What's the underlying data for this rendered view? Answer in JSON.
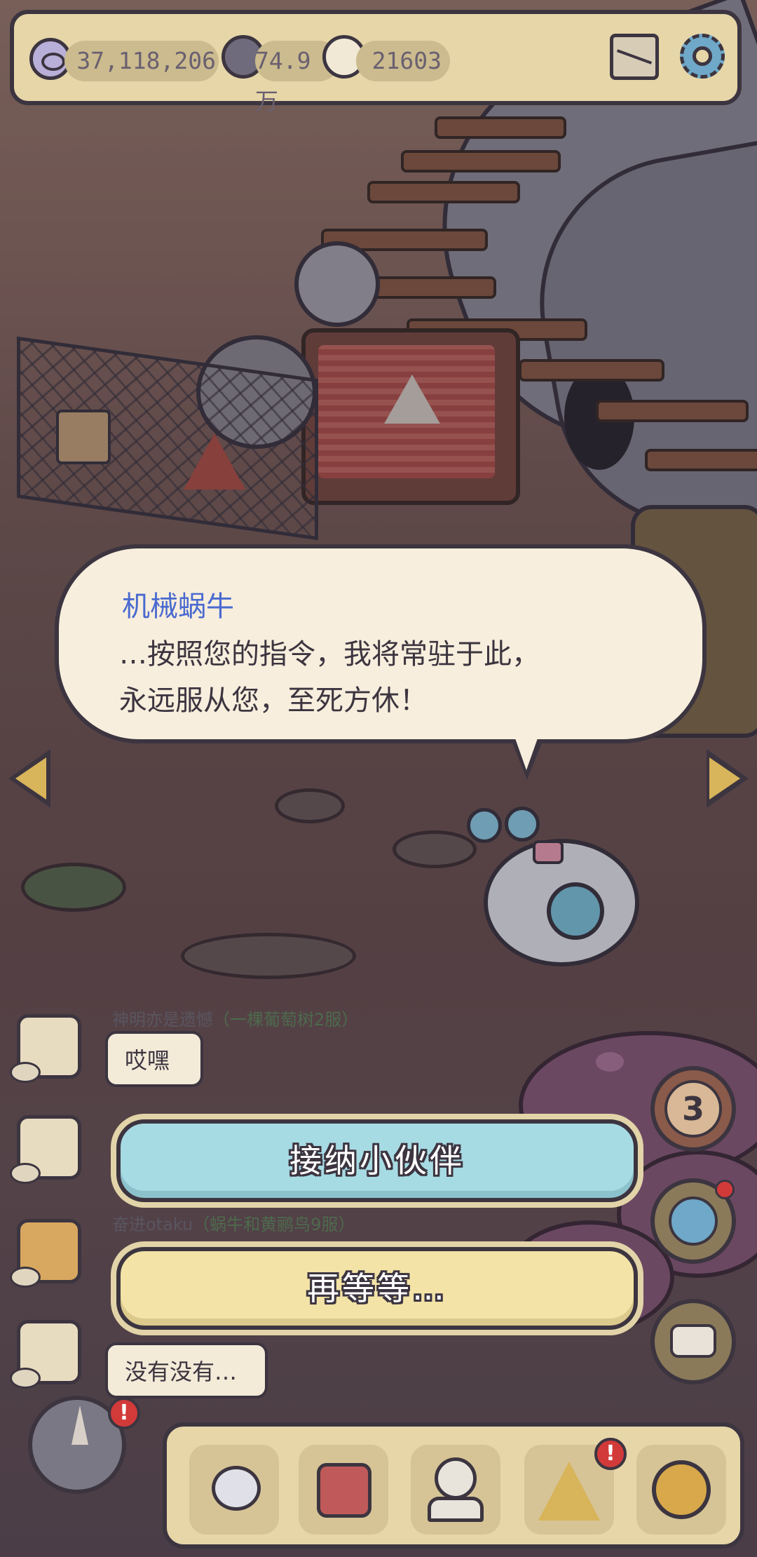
{
  "top_bar": {
    "views": "37,118,206",
    "comments": "74.9万",
    "messages": "21603"
  },
  "dialog": {
    "speaker": "机械蜗牛",
    "line1": "…按照您的指令，我将常驻于此，",
    "line2": "永远服从您，至死方休！"
  },
  "chat": {
    "messages": [
      {
        "user": "神明亦是遗憾",
        "server": "（一棵葡萄树2服）",
        "text": "哎嘿"
      },
      {
        "user": "",
        "server": "",
        "text": ""
      },
      {
        "user": "奋进otaku",
        "server": "（蜗牛和黄鹂鸟9服）",
        "text": ""
      },
      {
        "user": "",
        "server": "",
        "text": "没有没有…"
      }
    ]
  },
  "buttons": {
    "accept": "接纳小伙伴",
    "wait": "再等等…"
  },
  "right_panel": {
    "counter": "3"
  },
  "badges": {
    "compass": "!",
    "pyramid": "!"
  },
  "icons": {
    "eye": "eye-icon",
    "mail": "mail-icon",
    "settings": "gear-icon",
    "comment": "comment-icon",
    "message": "chat-icon",
    "compass": "compass-icon",
    "snail": "snail-icon",
    "backpack": "backpack-icon",
    "statue": "bust-icon",
    "pyramid": "pyramid-eye-icon",
    "coin": "coin-icon"
  },
  "colors": {
    "speaker_name": "#4a6ad0",
    "accept_button": "#a7dbe4",
    "wait_button": "#f3e3a6",
    "panel": "#e6d6a8",
    "badge": "#d23a3a"
  }
}
